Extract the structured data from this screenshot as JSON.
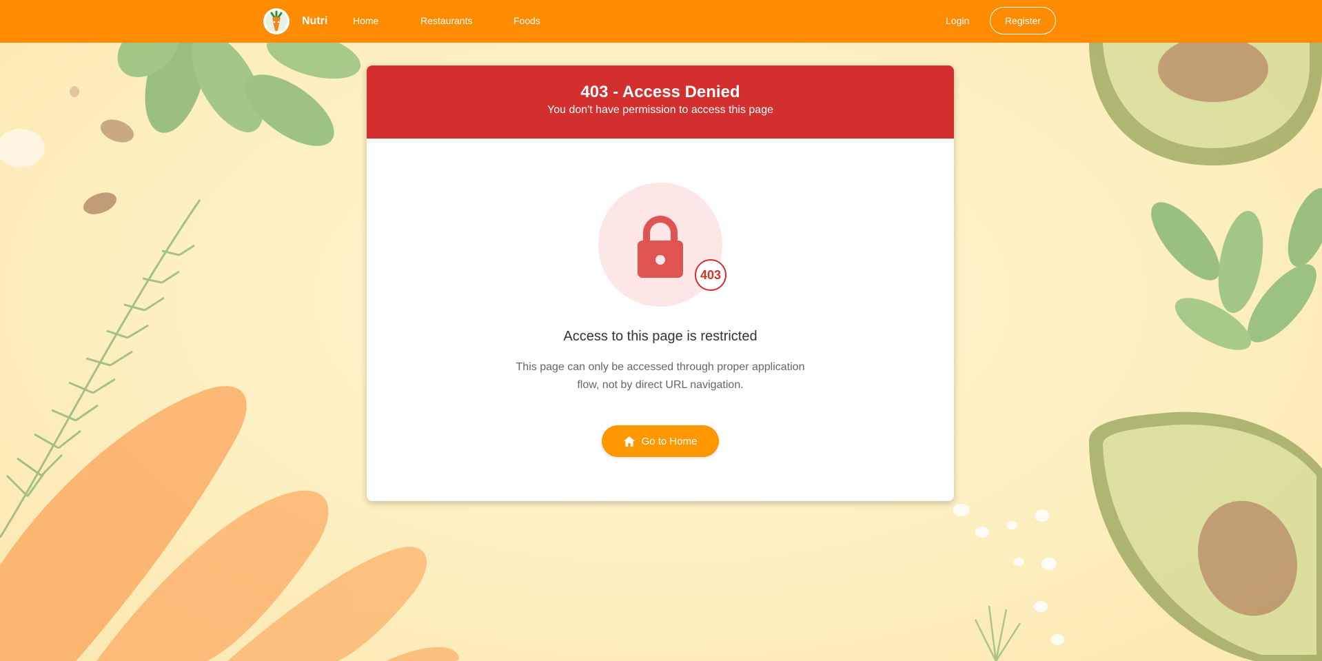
{
  "navbar": {
    "brand_name": "Nutri",
    "links": {
      "home": "Home",
      "restaurants": "Restaurants",
      "foods": "Foods"
    },
    "login": "Login",
    "register": "Register",
    "color": "#ff8c00"
  },
  "error": {
    "title": "403 - Access Denied",
    "subtitle": "You don't have permission to access this page",
    "code": "403",
    "heading": "Access to this page is restricted",
    "message": "This page can only be accessed through proper application flow, not by direct URL navigation.",
    "button_label": "Go to Home",
    "header_color": "#d32f2f",
    "button_color": "#ff9800"
  },
  "icons": {
    "brand": "carrot-logo-icon",
    "lock": "lock-icon",
    "home": "home-icon"
  }
}
